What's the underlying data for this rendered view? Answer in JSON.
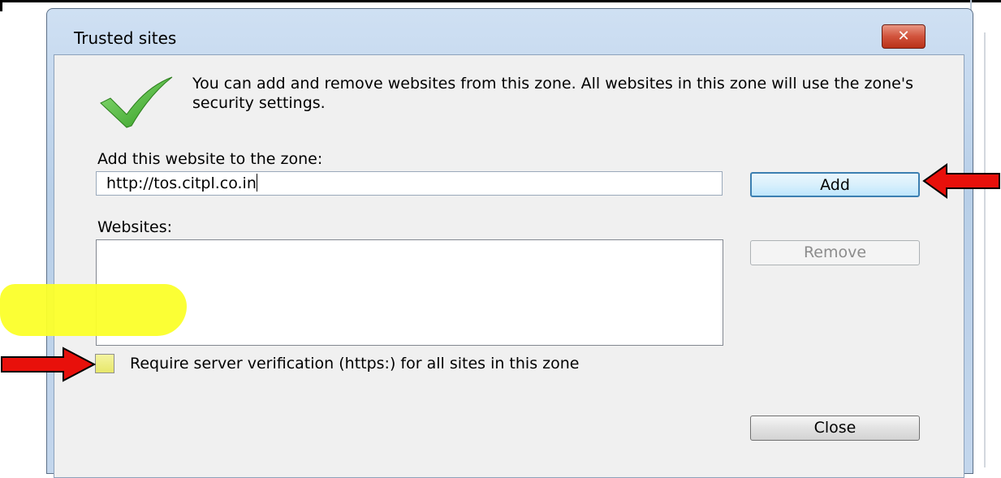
{
  "dialog": {
    "title": "Trusted sites",
    "close_glyph": "✕",
    "description": "You can add and remove websites from this zone. All websites in this zone will use the zone's security settings.",
    "add_label": "Add this website to the zone:",
    "url_value": "http://tos.citpl.co.in",
    "add_button": "Add",
    "websites_label": "Websites:",
    "websites": [],
    "remove_button": "Remove",
    "require_https_label": "Require server verification (https:) for all sites in this zone",
    "require_https_checked": false,
    "close_button": "Close"
  },
  "icons": {
    "zone": "green-checkmark-icon",
    "annotation_arrow": "red-arrow-icon"
  },
  "colors": {
    "checkmark": "#3fae2a",
    "highlight": "#fbff2a",
    "arrow": "#e8100b",
    "close_button": "#c94a30"
  }
}
